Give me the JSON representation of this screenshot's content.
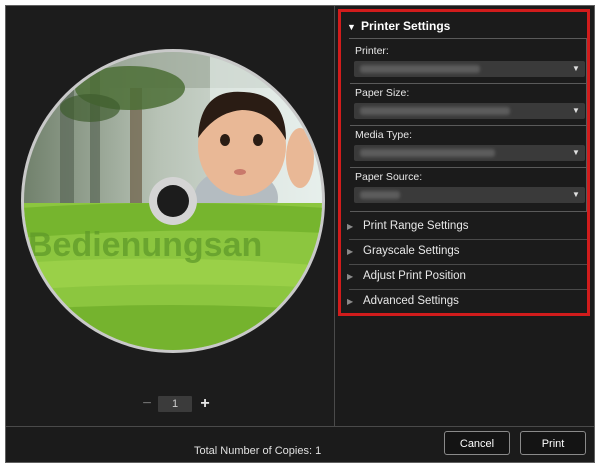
{
  "printer_settings": {
    "title": "Printer Settings",
    "fields": [
      {
        "label": "Printer:",
        "value": ""
      },
      {
        "label": "Paper Size:",
        "value": ""
      },
      {
        "label": "Media Type:",
        "value": ""
      },
      {
        "label": "Paper Source:",
        "value": ""
      }
    ]
  },
  "collapsed_sections": [
    "Print Range Settings",
    "Grayscale Settings",
    "Adjust Print Position",
    "Advanced Settings"
  ],
  "preview": {
    "disc_label_text": "Bedienungsan",
    "copies_value": "1",
    "minus_symbol": "−",
    "plus_symbol": "+"
  },
  "footer": {
    "total_copies_label": "Total Number of Copies:",
    "total_copies_value": "1",
    "cancel_label": "Cancel",
    "print_label": "Print"
  },
  "colors": {
    "highlight_border": "#d11c1c",
    "disc_green": "#8cc63f",
    "background": "#1b1b1b"
  }
}
